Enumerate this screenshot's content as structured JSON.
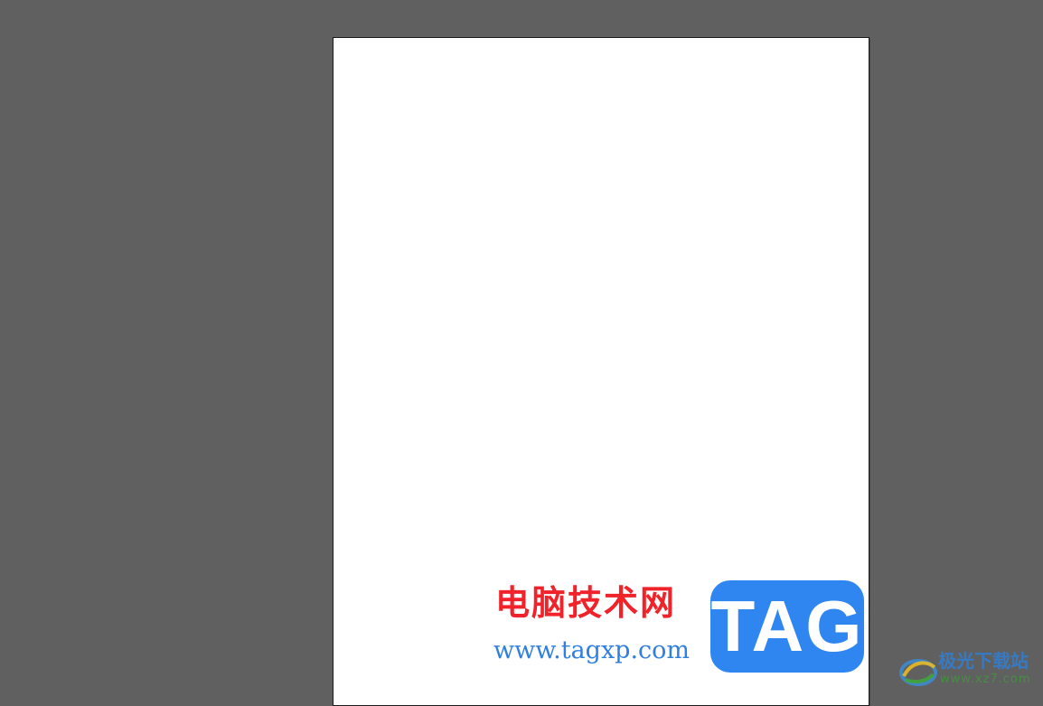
{
  "workspace": {
    "background_color": "#606060",
    "artboard_color": "#ffffff",
    "artboard_border_color": "#1a1a1a"
  },
  "watermarks": {
    "tagxp": {
      "site_name": "电脑技术网",
      "url": "www.tagxp.com",
      "badge": "TAG",
      "colors": {
        "site_name": "#f0222a",
        "url": "#2f7fe0",
        "badge_bg": "#2f86f0"
      }
    },
    "xz7": {
      "name": "极光下载站",
      "domain": "www.xz7.com",
      "logo_icon": "aurora-swirl-icon"
    }
  }
}
